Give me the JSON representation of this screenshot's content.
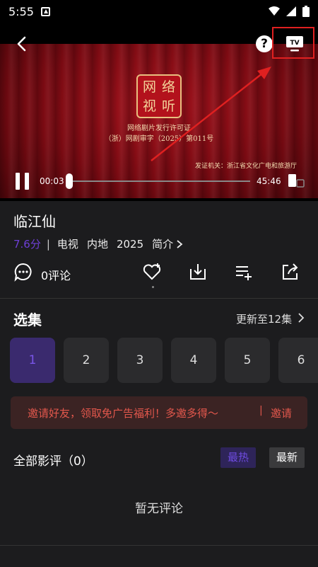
{
  "status_bar": {
    "time": "5:55"
  },
  "video": {
    "seal_chars": [
      "网",
      "络",
      "视",
      "听"
    ],
    "license_line1": "网络剧片发行许可证",
    "license_line2": "（浙）网剧审字（2025）第011号",
    "issuer": "发证机关：浙江省文化广电和旅游厅",
    "current_time": "00:03",
    "duration": "45:46",
    "help_label": "?",
    "annotation_color": "#e02020"
  },
  "show": {
    "title": "临江仙",
    "score": "7.6分",
    "separator": "|",
    "tags": [
      "电视",
      "内地",
      "2025"
    ],
    "intro_label": "简介",
    "comments_label": "0评论"
  },
  "episodes": {
    "title": "选集",
    "update_text": "更新至12集",
    "items": [
      "1",
      "2",
      "3",
      "4",
      "5",
      "6"
    ],
    "selected": "1"
  },
  "invite": {
    "text": "邀请好友，领取免广告福利！多邀多得～",
    "divider": "|",
    "button": "邀请"
  },
  "reviews": {
    "title": "全部影评（0）",
    "sort_hot": "最热",
    "sort_new": "最新",
    "empty_text": "暂无评论"
  },
  "colors": {
    "accent": "#6e3fd6",
    "invite_text": "#e2574c",
    "background": "#1c1c1e"
  }
}
